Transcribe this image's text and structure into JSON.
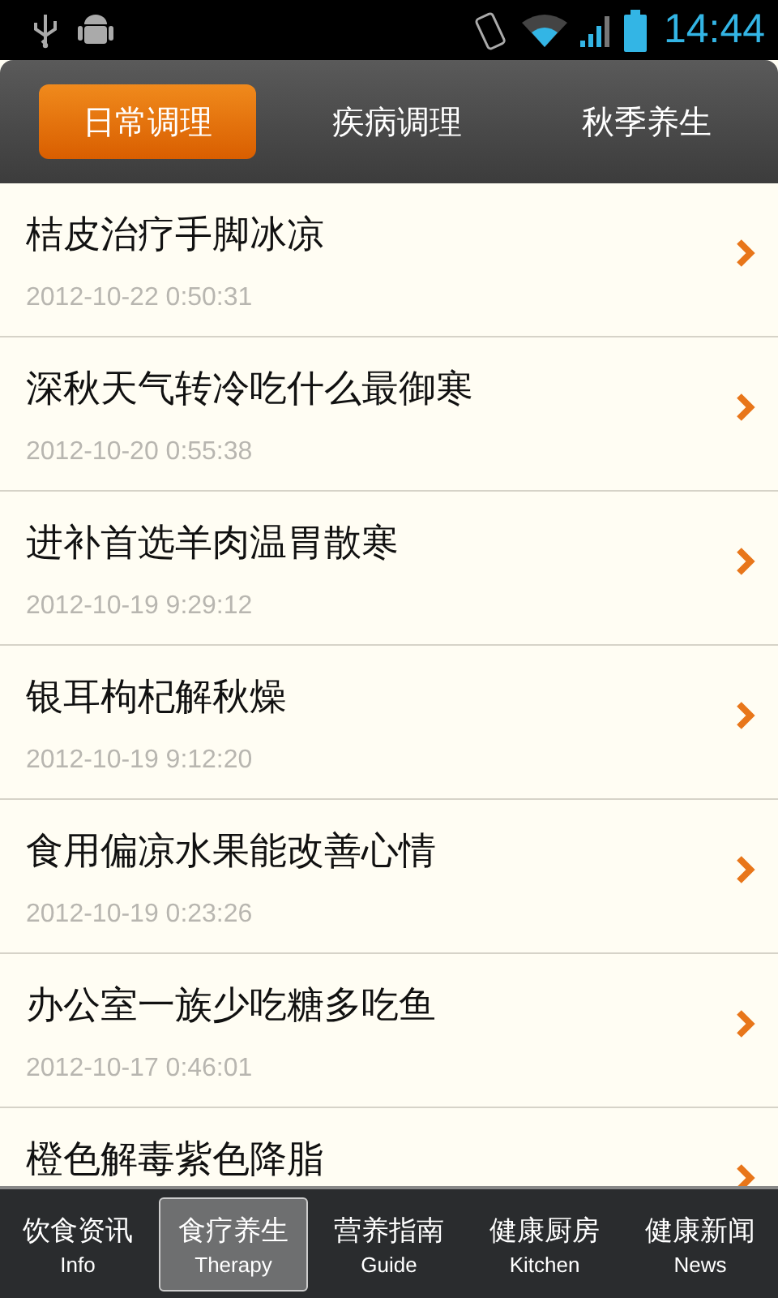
{
  "status_bar": {
    "time": "14:44"
  },
  "tabs": [
    {
      "label": "日常调理",
      "selected": true
    },
    {
      "label": "疾病调理",
      "selected": false
    },
    {
      "label": "秋季养生",
      "selected": false
    }
  ],
  "articles": [
    {
      "title": "桔皮治疗手脚冰凉",
      "date": "2012-10-22 0:50:31"
    },
    {
      "title": "深秋天气转冷吃什么最御寒",
      "date": "2012-10-20 0:55:38"
    },
    {
      "title": "进补首选羊肉温胃散寒",
      "date": "2012-10-19 9:29:12"
    },
    {
      "title": "银耳枸杞解秋燥",
      "date": "2012-10-19 9:12:20"
    },
    {
      "title": "食用偏凉水果能改善心情",
      "date": "2012-10-19 0:23:26"
    },
    {
      "title": "办公室一族少吃糖多吃鱼",
      "date": "2012-10-17 0:46:01"
    },
    {
      "title": "橙色解毒紫色降脂"
    }
  ],
  "bottom_nav": [
    {
      "label": "饮食资讯",
      "sublabel": "Info",
      "selected": false
    },
    {
      "label": "食疗养生",
      "sublabel": "Therapy",
      "selected": true
    },
    {
      "label": "营养指南",
      "sublabel": "Guide",
      "selected": false
    },
    {
      "label": "健康厨房",
      "sublabel": "Kitchen",
      "selected": false
    },
    {
      "label": "健康新闻",
      "sublabel": "News",
      "selected": false
    }
  ]
}
